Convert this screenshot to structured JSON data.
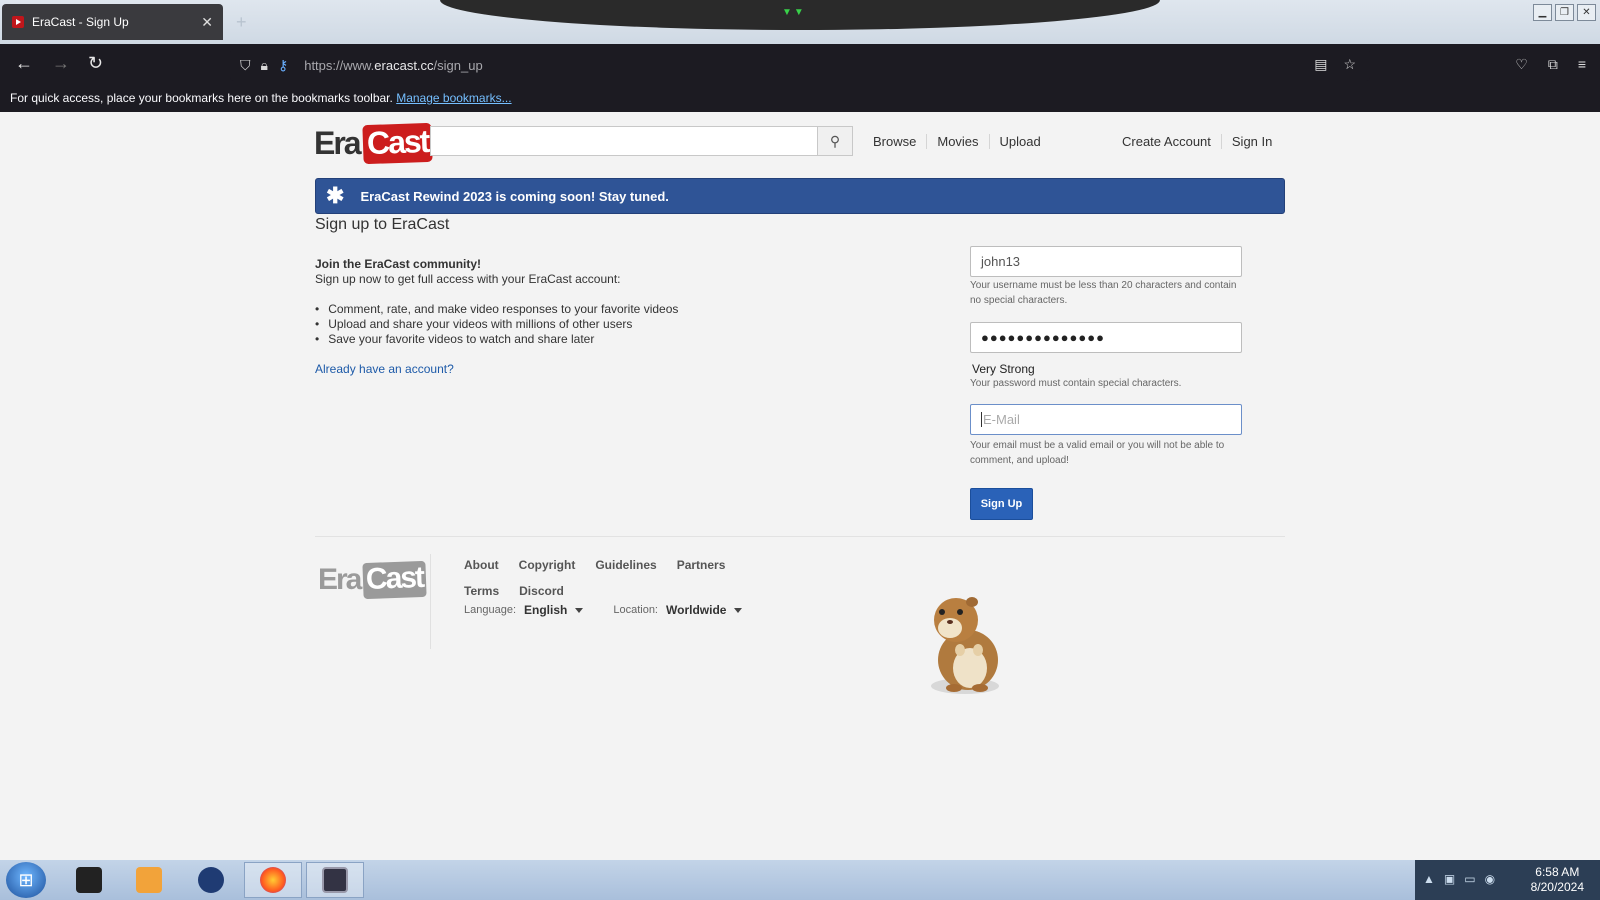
{
  "browser": {
    "tab_title": "EraCast - Sign Up",
    "tab_close": "✕",
    "new_tab": "+",
    "url_prefix": "https://www.",
    "url_domain": "eracast.cc",
    "url_path": "/sign_up",
    "bookmarks_text": "For quick access, place your bookmarks here on the bookmarks toolbar.",
    "bookmarks_link": "Manage bookmarks..."
  },
  "site": {
    "logo_era": "Era",
    "logo_cast": "Cast",
    "search_icon": "search-icon",
    "nav": {
      "browse": "Browse",
      "movies": "Movies",
      "upload": "Upload",
      "create_account": "Create Account",
      "sign_in": "Sign In"
    },
    "banner": "EraCast Rewind 2023 is coming soon! Stay tuned."
  },
  "signup": {
    "heading": "Sign up to EraCast",
    "join_title": "Join the EraCast community!",
    "join_sub": "Sign up now to get full access with your EraCast account:",
    "bullets": [
      "Comment, rate, and make video responses to your favorite videos",
      "Upload and share your videos with millions of other users",
      "Save your favorite videos to watch and share later"
    ],
    "already_link": "Already have an account?",
    "username_value": "john13",
    "username_help": "Your username must be less than 20 characters and contain no special characters.",
    "password_value": "●●●●●●●●●●●●●●",
    "password_strength": "Very Strong",
    "password_help": "Your password must contain special characters.",
    "email_placeholder": "E-Mail",
    "email_help": "Your email must be a valid email or you will not be able to comment, and upload!",
    "submit_label": "Sign Up"
  },
  "footer": {
    "links_row1": [
      "About",
      "Copyright",
      "Guidelines",
      "Partners"
    ],
    "links_row2": [
      "Terms",
      "Discord"
    ],
    "language_label": "Language:",
    "language_value": "English",
    "location_label": "Location:",
    "location_value": "Worldwide"
  },
  "taskbar": {
    "time": "6:58 AM",
    "date": "8/20/2024"
  },
  "colors": {
    "brand_red": "#cc1d1d",
    "banner_blue": "#2f5496",
    "button_blue": "#2a62b8",
    "link_blue": "#1d5aa8"
  }
}
